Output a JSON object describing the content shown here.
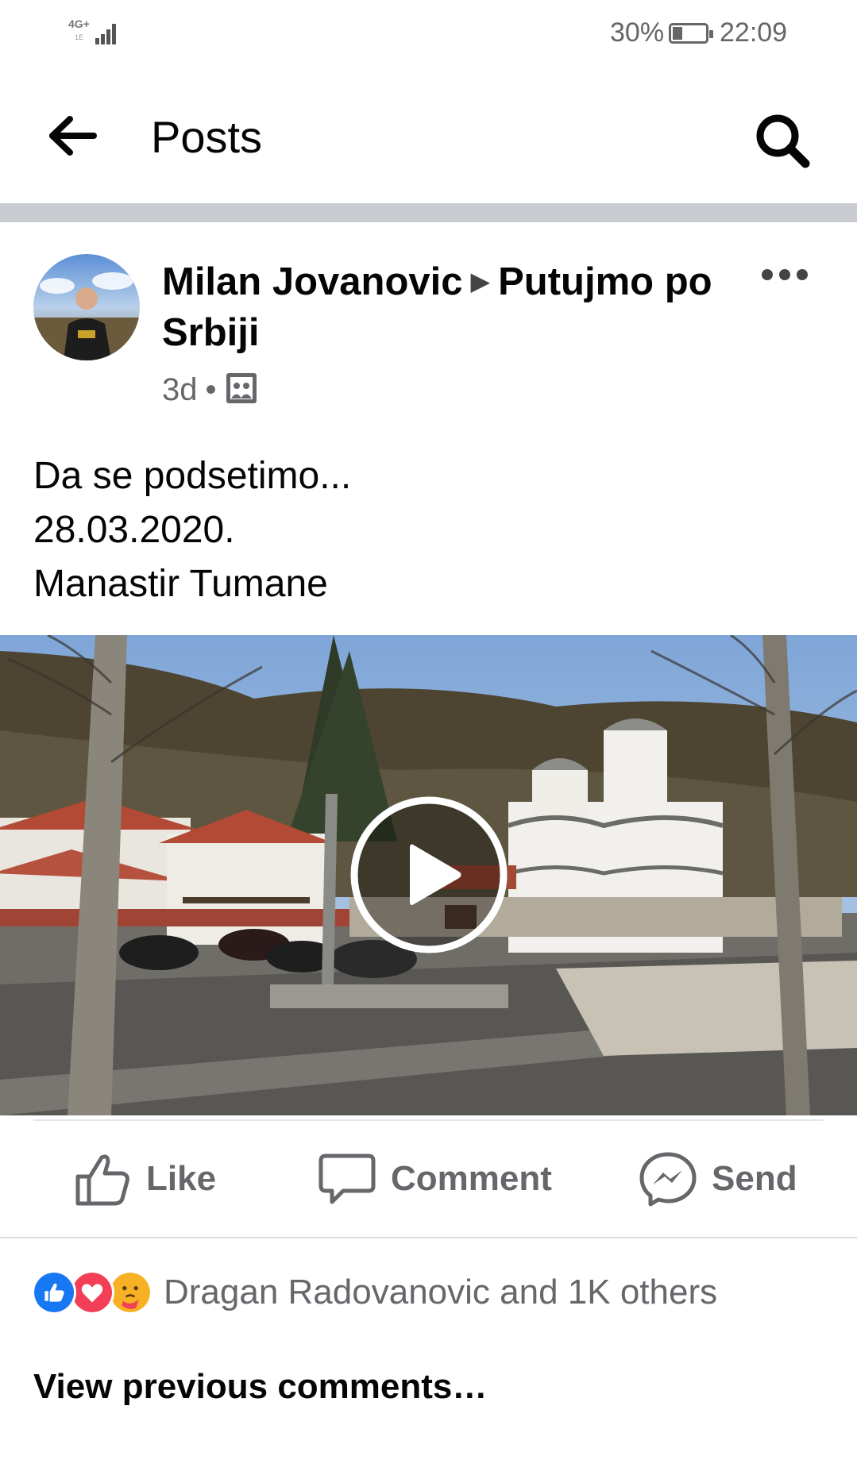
{
  "status_bar": {
    "network": "4G+",
    "network_sub": "1E",
    "battery_percent": "30%",
    "battery_level": 0.3,
    "time": "22:09"
  },
  "header": {
    "title": "Posts",
    "back_icon": "back-arrow-icon",
    "search_icon": "search-icon"
  },
  "post": {
    "author": "Milan Jovanovic",
    "separator": "▶",
    "group": "Putujmo po Srbiji",
    "age": "3d",
    "meta_dot": "•",
    "audience_icon": "photo-album-icon",
    "text_lines": [
      "Da se podsetimo...",
      "28.03.2020.",
      "Manastir Tumane"
    ],
    "media_type": "video"
  },
  "actions": {
    "like": "Like",
    "comment": "Comment",
    "send": "Send"
  },
  "reactions": {
    "icons": [
      "like-reaction-icon",
      "love-reaction-icon",
      "care-reaction-icon"
    ],
    "summary": "Dragan Radovanovic and 1K others"
  },
  "comments": {
    "view_previous": "View previous comments…"
  },
  "colors": {
    "like_blue": "#1877f2",
    "love_red": "#f33e58",
    "care_yellow": "#f7b125",
    "secondary_text": "#65676b",
    "divider": "#c9ccd1"
  }
}
